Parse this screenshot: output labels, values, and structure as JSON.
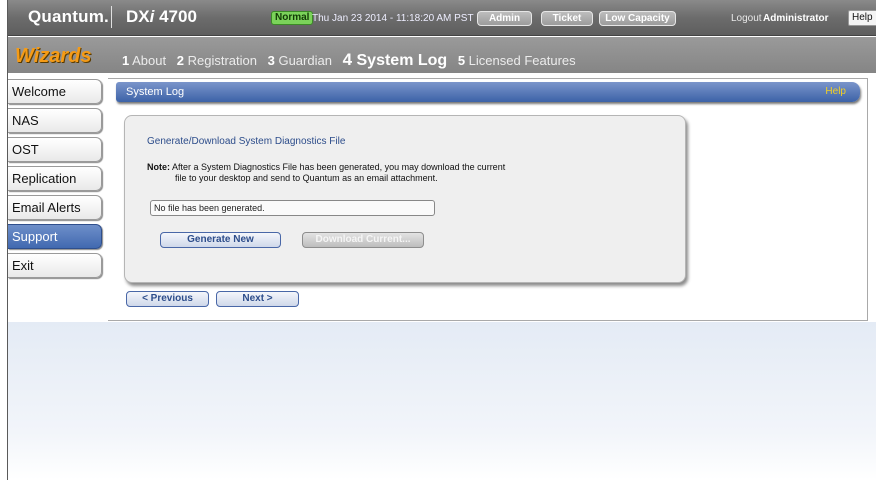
{
  "header": {
    "brand": "Quantum.",
    "model_prefix": "DX",
    "model_italic": "i",
    "model_suffix": " 4700",
    "status": "Normal",
    "datetime": "Thu Jan 23 2014 - 11:18:20 AM PST",
    "admin_label": "Admin",
    "ticket_label": "Ticket",
    "capacity_label": "Low Capacity",
    "logout_label": "Logout",
    "user": "Administrator",
    "help_label": "Help"
  },
  "wizard": {
    "title": "Wizards",
    "steps": [
      {
        "num": "1",
        "label": "About"
      },
      {
        "num": "2",
        "label": "Registration"
      },
      {
        "num": "3",
        "label": "Guardian"
      },
      {
        "num": "4",
        "label": "System Log"
      },
      {
        "num": "5",
        "label": "Licensed Features"
      }
    ],
    "active_step": 4
  },
  "sidebar": {
    "items": [
      {
        "label": "Welcome"
      },
      {
        "label": "NAS"
      },
      {
        "label": "OST"
      },
      {
        "label": "Replication"
      },
      {
        "label": "Email Alerts"
      },
      {
        "label": "Support"
      },
      {
        "label": "Exit"
      }
    ],
    "active": "Support"
  },
  "main": {
    "title": "System Log",
    "help_label": "Help",
    "panel_title": "Generate/Download System Diagnostics File",
    "note_label": "Note:",
    "note_line1": "After a System Diagnostics File has been generated, you may download the current",
    "note_line2": "file to your desktop and send to Quantum as an email attachment.",
    "file_status": "No file has been generated.",
    "generate_label": "Generate New",
    "download_label": "Download Current..."
  },
  "footer_nav": {
    "previous_label": "< Previous",
    "next_label": "Next >"
  },
  "colors": {
    "accent_blue": "#3c62a7",
    "wizard_orange": "#f59b16",
    "status_green": "#7bd35a"
  }
}
